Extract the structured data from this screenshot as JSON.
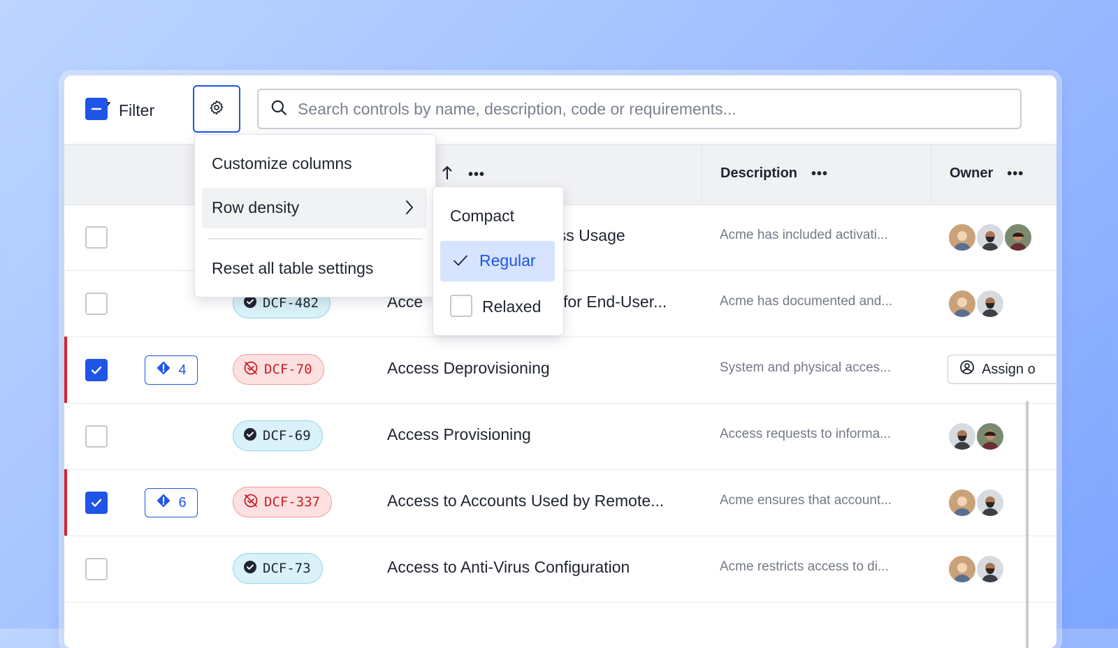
{
  "toolbar": {
    "filter_label": "Filter",
    "settings_icon": "gear-icon",
    "search_placeholder": "Search controls by name, description, code or requirements..."
  },
  "table": {
    "columns": [
      {
        "label": "Description"
      },
      {
        "label": "Owner"
      }
    ],
    "header_more": "•••",
    "rows": [
      {
        "checked": false,
        "flagged": false,
        "issues": "",
        "code": "",
        "code_status": "",
        "name": "ess Usage",
        "description": "Acme has included activati...",
        "owners": 3
      },
      {
        "checked": false,
        "flagged": false,
        "issues": "",
        "code": "DCF-482",
        "code_status": "ok",
        "name": "Acce",
        "name_suffix": "for End-User...",
        "description": "Acme has documented and...",
        "owners": 2
      },
      {
        "checked": true,
        "flagged": true,
        "issues": "4",
        "code": "DCF-70",
        "code_status": "bad",
        "name": "Access Deprovisioning",
        "description": "System and physical acces...",
        "assign_label": "Assign o"
      },
      {
        "checked": false,
        "flagged": false,
        "issues": "",
        "code": "DCF-69",
        "code_status": "ok",
        "name": "Access Provisioning",
        "description": "Access requests to informa...",
        "owners": 2
      },
      {
        "checked": true,
        "flagged": true,
        "issues": "6",
        "code": "DCF-337",
        "code_status": "bad",
        "name": "Access to Accounts Used by Remote...",
        "description": "Acme ensures that account...",
        "owners": 2
      },
      {
        "checked": false,
        "flagged": false,
        "issues": "",
        "code": "DCF-73",
        "code_status": "ok",
        "name": "Access to Anti-Virus Configuration",
        "description": "Acme restricts access to di...",
        "owners": 2
      }
    ]
  },
  "settings_menu": {
    "items": [
      "Customize columns",
      "Row density",
      "Reset all table settings"
    ]
  },
  "density_menu": {
    "options": [
      "Compact",
      "Regular",
      "Relaxed"
    ],
    "selected": "Regular"
  },
  "colors": {
    "accent": "#1f55e6",
    "danger": "#d9232e",
    "ok_badge_bg": "#d9f1f8",
    "bad_badge_bg": "#fde0e0",
    "selected_bg": "#d6e4ff"
  }
}
